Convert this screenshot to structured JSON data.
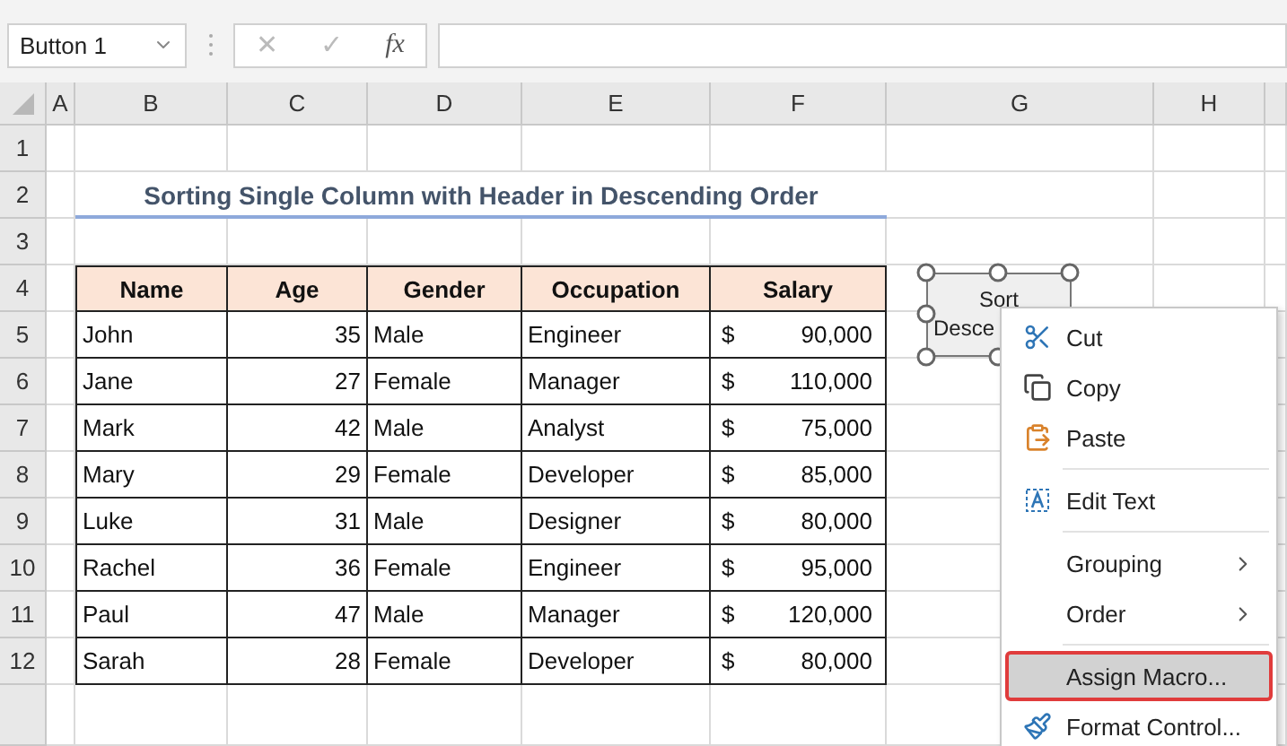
{
  "name_box": {
    "value": "Button 1"
  },
  "formula_buttons": [
    "✕",
    "✓",
    "fx"
  ],
  "columns": [
    "A",
    "B",
    "C",
    "D",
    "E",
    "F",
    "G",
    "H"
  ],
  "rows": [
    "1",
    "2",
    "3",
    "4",
    "5",
    "6",
    "7",
    "8",
    "9",
    "10",
    "11",
    "12"
  ],
  "title": "Sorting Single Column with Header in Descending Order",
  "table": {
    "columns": [
      "Name",
      "Age",
      "Gender",
      "Occupation",
      "Salary"
    ],
    "rows": [
      {
        "name": "John",
        "age": "35",
        "gender": "Male",
        "occupation": "Engineer",
        "currency": "$",
        "salary": "90,000"
      },
      {
        "name": "Jane",
        "age": "27",
        "gender": "Female",
        "occupation": "Manager",
        "currency": "$",
        "salary": "110,000"
      },
      {
        "name": "Mark",
        "age": "42",
        "gender": "Male",
        "occupation": "Analyst",
        "currency": "$",
        "salary": "75,000"
      },
      {
        "name": "Mary",
        "age": "29",
        "gender": "Female",
        "occupation": "Developer",
        "currency": "$",
        "salary": "85,000"
      },
      {
        "name": "Luke",
        "age": "31",
        "gender": "Male",
        "occupation": "Designer",
        "currency": "$",
        "salary": "80,000"
      },
      {
        "name": "Rachel",
        "age": "36",
        "gender": "Female",
        "occupation": "Engineer",
        "currency": "$",
        "salary": "95,000"
      },
      {
        "name": "Paul",
        "age": "47",
        "gender": "Male",
        "occupation": "Manager",
        "currency": "$",
        "salary": "120,000"
      },
      {
        "name": "Sarah",
        "age": "28",
        "gender": "Female",
        "occupation": "Developer",
        "currency": "$",
        "salary": "80,000"
      }
    ]
  },
  "sheet_button": {
    "lines": [
      "Sort",
      "Desce"
    ],
    "selected": true
  },
  "context_menu": [
    {
      "kind": "command",
      "label": "Cut",
      "submenu": false,
      "selected": false
    },
    {
      "kind": "command",
      "label": "Copy",
      "submenu": false,
      "selected": false
    },
    {
      "kind": "command",
      "label": "Paste",
      "submenu": false,
      "selected": false
    },
    {
      "kind": "separator"
    },
    {
      "kind": "command",
      "label": "Edit Text",
      "submenu": false,
      "selected": false
    },
    {
      "kind": "separator"
    },
    {
      "kind": "command",
      "label": "Grouping",
      "submenu": true,
      "selected": false
    },
    {
      "kind": "command",
      "label": "Order",
      "submenu": true,
      "selected": false
    },
    {
      "kind": "separator"
    },
    {
      "kind": "command",
      "label": "Assign Macro...",
      "submenu": false,
      "selected": true
    },
    {
      "kind": "command",
      "label": "Format Control...",
      "submenu": false,
      "selected": false
    }
  ]
}
